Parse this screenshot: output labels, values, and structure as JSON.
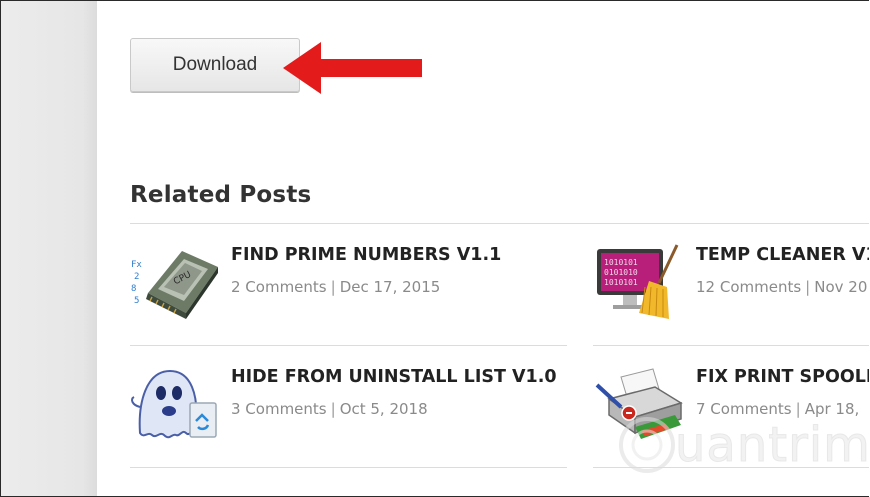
{
  "download": {
    "label": "Download"
  },
  "related": {
    "title": "Related Posts",
    "posts": [
      {
        "title": "FIND PRIME NUMBERS V1.1",
        "comments": "2 Comments",
        "date": "Dec 17, 2015",
        "icon": "cpu-chip-icon"
      },
      {
        "title": "TEMP CLEANER V1",
        "comments": "12 Comments",
        "date": "Nov 20",
        "icon": "monitor-broom-icon"
      },
      {
        "title": "HIDE FROM UNINSTALL LIST V1.0",
        "comments": "3 Comments",
        "date": "Oct 5, 2018",
        "icon": "ghost-icon"
      },
      {
        "title": "FIX PRINT SPOOLE",
        "comments": "7 Comments",
        "date": "Apr 18,",
        "icon": "printer-icon"
      }
    ],
    "separator": "|"
  },
  "watermark": {
    "text": "uantrimang"
  },
  "colors": {
    "arrow": "#e41b1b",
    "title_text": "#222222",
    "meta_text": "#8a8a8a"
  }
}
